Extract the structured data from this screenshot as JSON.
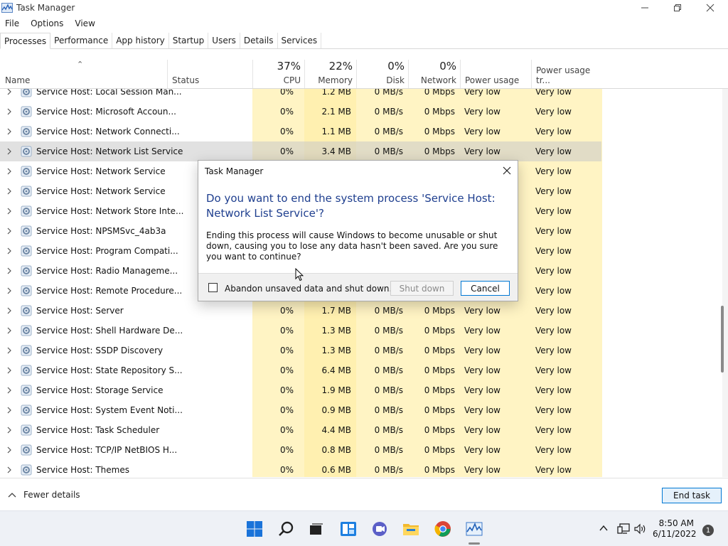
{
  "window": {
    "title": "Task Manager"
  },
  "menu": [
    "File",
    "Options",
    "View"
  ],
  "tabs": [
    "Processes",
    "Performance",
    "App history",
    "Startup",
    "Users",
    "Details",
    "Services"
  ],
  "header": {
    "name": "Name",
    "status": "Status",
    "cpu": {
      "pct": "37%",
      "label": "CPU"
    },
    "memory": {
      "pct": "22%",
      "label": "Memory"
    },
    "disk": {
      "pct": "0%",
      "label": "Disk"
    },
    "network": {
      "pct": "0%",
      "label": "Network"
    },
    "power": "Power usage",
    "power_trend": "Power usage tr..."
  },
  "rows": [
    {
      "name": "Service Host: Local Session Man...",
      "cpu": "0%",
      "mem": "1.2 MB",
      "disk": "0 MB/s",
      "net": "0 Mbps",
      "power": "Very low",
      "trend": "Very low"
    },
    {
      "name": "Service Host: Microsoft Accoun...",
      "cpu": "0%",
      "mem": "2.1 MB",
      "disk": "0 MB/s",
      "net": "0 Mbps",
      "power": "Very low",
      "trend": "Very low"
    },
    {
      "name": "Service Host: Network Connecti...",
      "cpu": "0%",
      "mem": "1.1 MB",
      "disk": "0 MB/s",
      "net": "0 Mbps",
      "power": "Very low",
      "trend": "Very low"
    },
    {
      "name": "Service Host: Network List Service",
      "cpu": "0%",
      "mem": "3.4 MB",
      "disk": "0 MB/s",
      "net": "0 Mbps",
      "power": "Very low",
      "trend": "Very low",
      "selected": true
    },
    {
      "name": "Service Host: Network Service",
      "cpu": "",
      "mem": "",
      "disk": "",
      "net": "",
      "power": "",
      "trend": "Very low"
    },
    {
      "name": "Service Host: Network Service",
      "cpu": "",
      "mem": "",
      "disk": "",
      "net": "",
      "power": "",
      "trend": "Very low"
    },
    {
      "name": "Service Host: Network Store Inte...",
      "cpu": "",
      "mem": "",
      "disk": "",
      "net": "",
      "power": "",
      "trend": "Very low"
    },
    {
      "name": "Service Host: NPSMSvc_4ab3a",
      "cpu": "",
      "mem": "",
      "disk": "",
      "net": "",
      "power": "",
      "trend": "Very low"
    },
    {
      "name": "Service Host: Program Compati...",
      "cpu": "",
      "mem": "",
      "disk": "",
      "net": "",
      "power": "",
      "trend": "Very low"
    },
    {
      "name": "Service Host: Radio Manageme...",
      "cpu": "",
      "mem": "",
      "disk": "",
      "net": "",
      "power": "",
      "trend": "Very low"
    },
    {
      "name": "Service Host: Remote Procedure...",
      "cpu": "",
      "mem": "",
      "disk": "",
      "net": "",
      "power": "",
      "trend": "Very low"
    },
    {
      "name": "Service Host: Server",
      "cpu": "0%",
      "mem": "1.7 MB",
      "disk": "0 MB/s",
      "net": "0 Mbps",
      "power": "Very low",
      "trend": "Very low"
    },
    {
      "name": "Service Host: Shell Hardware De...",
      "cpu": "0%",
      "mem": "1.3 MB",
      "disk": "0 MB/s",
      "net": "0 Mbps",
      "power": "Very low",
      "trend": "Very low"
    },
    {
      "name": "Service Host: SSDP Discovery",
      "cpu": "0%",
      "mem": "1.3 MB",
      "disk": "0 MB/s",
      "net": "0 Mbps",
      "power": "Very low",
      "trend": "Very low"
    },
    {
      "name": "Service Host: State Repository S...",
      "cpu": "0%",
      "mem": "6.4 MB",
      "disk": "0 MB/s",
      "net": "0 Mbps",
      "power": "Very low",
      "trend": "Very low"
    },
    {
      "name": "Service Host: Storage Service",
      "cpu": "0%",
      "mem": "1.9 MB",
      "disk": "0 MB/s",
      "net": "0 Mbps",
      "power": "Very low",
      "trend": "Very low"
    },
    {
      "name": "Service Host: System Event Noti...",
      "cpu": "0%",
      "mem": "0.9 MB",
      "disk": "0 MB/s",
      "net": "0 Mbps",
      "power": "Very low",
      "trend": "Very low"
    },
    {
      "name": "Service Host: Task Scheduler",
      "cpu": "0%",
      "mem": "4.4 MB",
      "disk": "0 MB/s",
      "net": "0 Mbps",
      "power": "Very low",
      "trend": "Very low"
    },
    {
      "name": "Service Host: TCP/IP NetBIOS H...",
      "cpu": "0%",
      "mem": "0.8 MB",
      "disk": "0 MB/s",
      "net": "0 Mbps",
      "power": "Very low",
      "trend": "Very low"
    },
    {
      "name": "Service Host: Themes",
      "cpu": "0%",
      "mem": "0.6 MB",
      "disk": "0 MB/s",
      "net": "0 Mbps",
      "power": "Very low",
      "trend": "Very low"
    }
  ],
  "footer": {
    "fewer_details": "Fewer details",
    "end_task": "End task"
  },
  "dialog": {
    "title": "Task Manager",
    "heading": "Do you want to end the system process 'Service Host: Network List Service'?",
    "body": "Ending this process will cause Windows to become unusable or shut down, causing you to lose any data hasn't been saved. Are you sure you want to continue?",
    "checkbox_label": "Abandon unsaved data and shut down.",
    "shutdown_label": "Shut down",
    "cancel_label": "Cancel"
  },
  "taskbar": {
    "icons": [
      "windows-start-icon",
      "search-icon",
      "task-view-icon",
      "widgets-icon",
      "chat-icon",
      "file-explorer-icon",
      "chrome-icon",
      "task-manager-icon"
    ],
    "time": "8:50 AM",
    "date": "6/11/2022",
    "notification_count": "1"
  },
  "colors": {
    "accent": "#0078d4",
    "heat": "#fff4c4",
    "heading": "#1f3f8f"
  }
}
